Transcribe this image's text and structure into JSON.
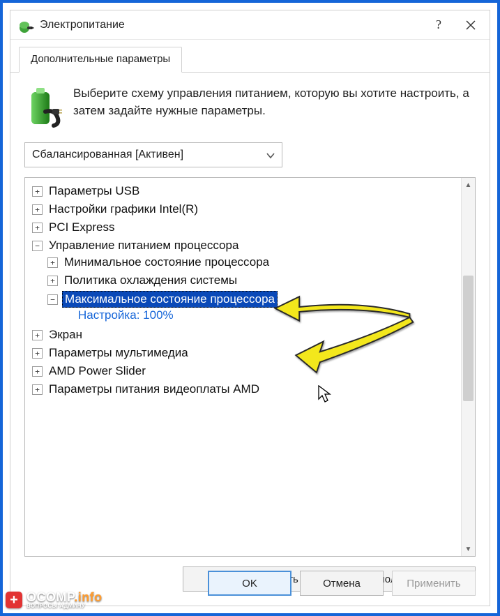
{
  "window": {
    "title": "Электропитание"
  },
  "tabs": {
    "advanced": "Дополнительные параметры"
  },
  "intro": {
    "text": "Выберите схему управления питанием, которую вы хотите настроить, а затем задайте нужные параметры."
  },
  "plan": {
    "selected": "Сбалансированная [Активен]"
  },
  "tree": {
    "items": [
      {
        "label": "Параметры USB",
        "expanded": false
      },
      {
        "label": "Настройки графики Intel(R)",
        "expanded": false
      },
      {
        "label": "PCI Express",
        "expanded": false
      },
      {
        "label": "Управление питанием процессора",
        "expanded": true,
        "children": [
          {
            "label": "Минимальное состояние процессора",
            "expanded": false
          },
          {
            "label": "Политика охлаждения системы",
            "expanded": false
          },
          {
            "label": "Максимальное состояние процессора",
            "expanded": true,
            "selected": true,
            "setting_label": "Настройка:",
            "setting_value": "100%"
          }
        ]
      },
      {
        "label": "Экран",
        "expanded": false
      },
      {
        "label": "Параметры мультимедиа",
        "expanded": false
      },
      {
        "label": "AMD Power Slider",
        "expanded": false
      },
      {
        "label": "Параметры питания видеоплаты AMD",
        "expanded": false
      }
    ]
  },
  "buttons": {
    "restore_defaults": "Восстановить параметры по умолчанию",
    "ok": "OK",
    "cancel": "Отмена",
    "apply": "Применить"
  },
  "watermark": {
    "main1": "OCOMP",
    "main2": ".info",
    "sub": "ВОПРОСЫ АДМИНУ"
  }
}
